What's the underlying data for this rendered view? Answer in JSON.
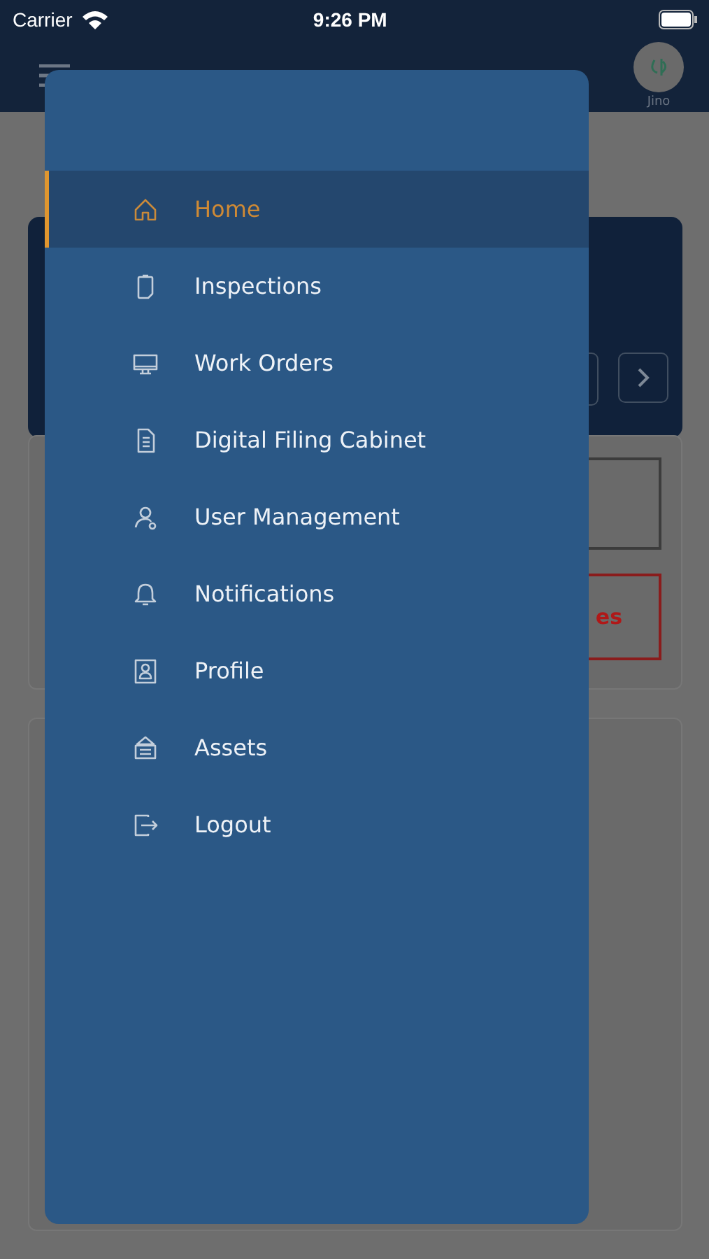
{
  "status_bar": {
    "carrier": "Carrier",
    "time": "9:26 PM"
  },
  "header": {
    "user": "Jino"
  },
  "background": {
    "alert_button": "es"
  },
  "menu": {
    "items": [
      {
        "label": "Home",
        "selected": true
      },
      {
        "label": "Inspections",
        "selected": false
      },
      {
        "label": "Work Orders",
        "selected": false
      },
      {
        "label": "Digital Filing Cabinet",
        "selected": false
      },
      {
        "label": "User Management",
        "selected": false
      },
      {
        "label": "Notifications",
        "selected": false
      },
      {
        "label": "Profile",
        "selected": false
      },
      {
        "label": "Assets",
        "selected": false
      },
      {
        "label": "Logout",
        "selected": false
      }
    ]
  }
}
